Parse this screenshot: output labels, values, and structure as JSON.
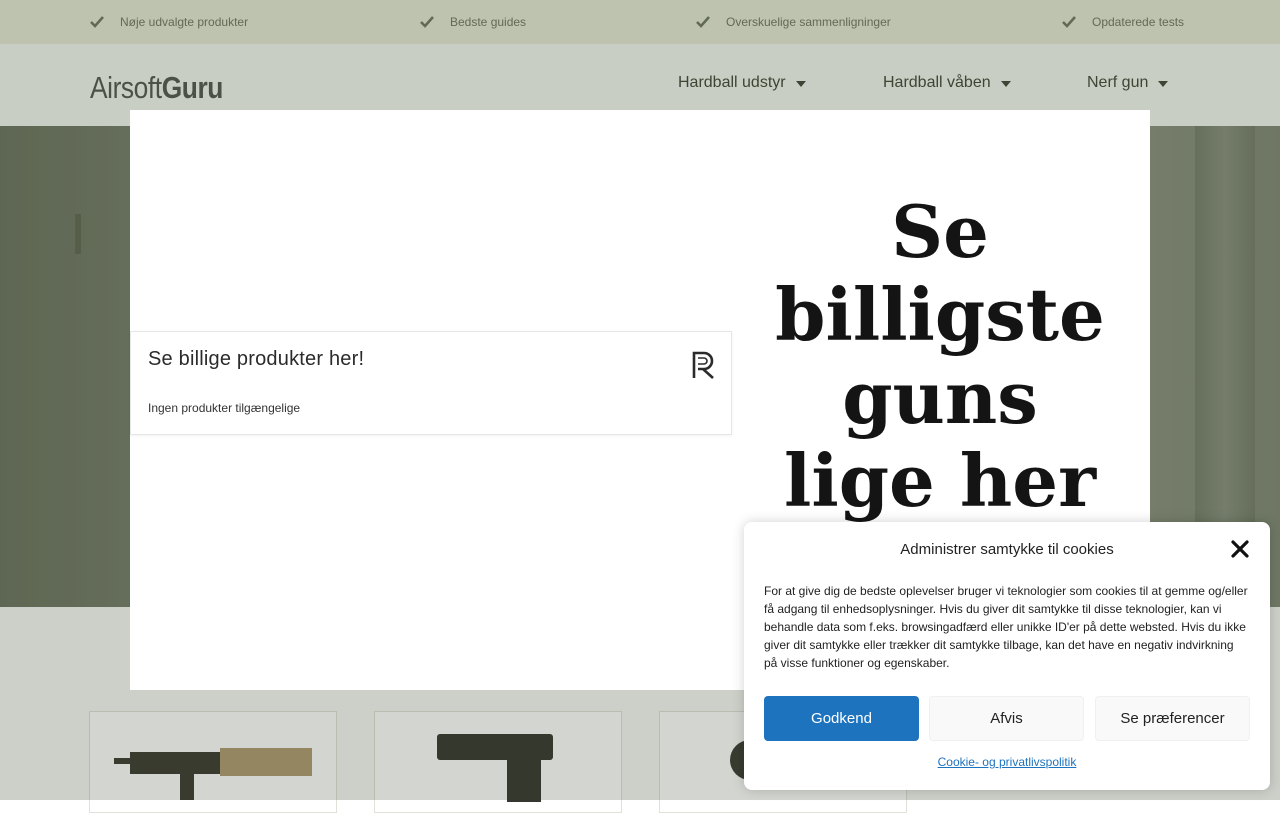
{
  "topbar": {
    "benefits": [
      "Nøje udvalgte produkter",
      "Bedste guides",
      "Overskuelige sammenligninger",
      "Opdaterede tests"
    ]
  },
  "header": {
    "logo_light": "Airsoft",
    "logo_bold": "Guru",
    "nav": [
      "Hardball udstyr",
      "Hardball våben",
      "Nerf gun"
    ]
  },
  "modal": {
    "widget_title": "Se billige produkter her!",
    "widget_empty": "Ingen produkter tilgængelige",
    "heading_lines": [
      "Se",
      "billigste",
      "guns",
      "lige her"
    ]
  },
  "cookie": {
    "title": "Administrer samtykke til cookies",
    "text": "For at give dig de bedste oplevelser bruger vi teknologier som cookies til at gemme og/eller få adgang til enhedsoplysninger. Hvis du giver dit samtykke til disse teknologier, kan vi behandle data som f.eks. browsingadfærd eller unikke ID'er på dette websted. Hvis du ikke giver dit samtykke eller trækker dit samtykke tilbage, kan det have en negativ indvirkning på visse funktioner og egenskaber.",
    "accept": "Godkend",
    "deny": "Afvis",
    "preferences": "Se præferencer",
    "policy_link": "Cookie- og privatlivspolitik"
  },
  "colors": {
    "accent": "#1e73be",
    "topbar_bg": "#e6e8d5",
    "header_bg": "#f4f7f1"
  }
}
